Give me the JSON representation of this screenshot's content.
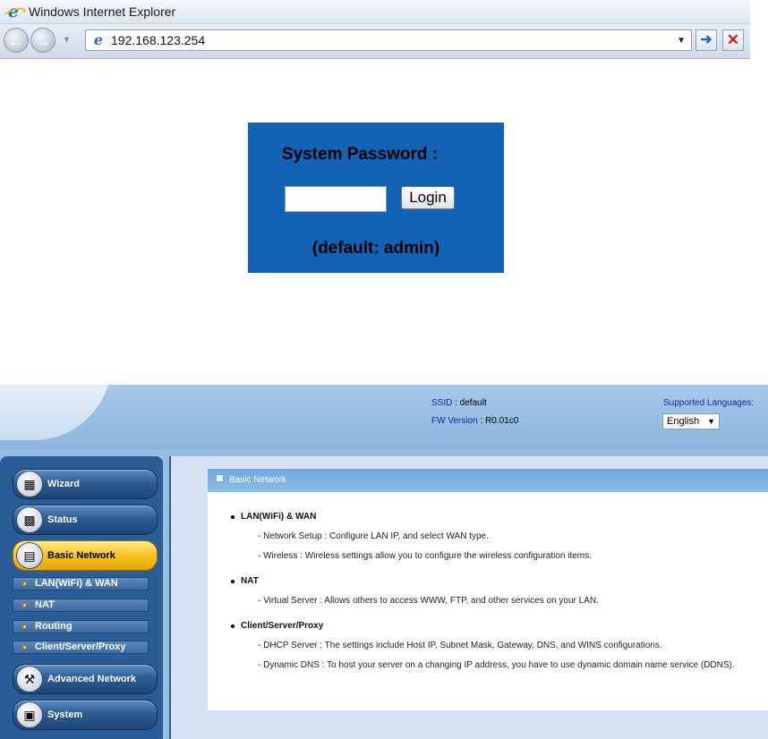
{
  "browser": {
    "window_title": "Windows Internet Explorer",
    "address": "192.168.123.254",
    "icons": [
      "ie-logo-icon",
      "back-arrow-icon",
      "forward-arrow-icon",
      "go-arrow-icon",
      "stop-x-icon"
    ]
  },
  "login": {
    "title": "System Password :",
    "password_value": "",
    "button_label": "Login",
    "hint": "(default: admin)",
    "panel_color": "#1262b6"
  },
  "header": {
    "ssid_label": "SSID",
    "ssid_value": ": default",
    "fw_label": "FW Version",
    "fw_value": ": R0.01c0",
    "languages_label": "Supported Languages:",
    "language_selected": "English"
  },
  "sidebar": {
    "items": [
      {
        "label": "Wizard",
        "icon": "wizard-icon"
      },
      {
        "label": "Status",
        "icon": "status-icon"
      },
      {
        "label": "Basic Network",
        "icon": "basic-network-icon",
        "active": true
      },
      {
        "label": "Advanced Network",
        "icon": "advanced-network-icon"
      },
      {
        "label": "System",
        "icon": "system-icon"
      }
    ],
    "subitems": [
      {
        "label": "LAN(WiFi) & WAN"
      },
      {
        "label": "NAT"
      },
      {
        "label": "Routing"
      },
      {
        "label": "Client/Server/Proxy"
      }
    ]
  },
  "content": {
    "title": "Basic Network",
    "sections": [
      {
        "title": "LAN(WiFi) & WAN",
        "items": [
          "- Network Setup : Configure LAN IP, and select WAN type.",
          "- Wireless : Wireless settings allow you to configure the wireless configuration items."
        ]
      },
      {
        "title": "NAT",
        "items": [
          "- Virtual Server : Allows others to access WWW, FTP, and other services on your LAN."
        ]
      },
      {
        "title": "Client/Server/Proxy",
        "items": [
          "- DHCP Server : The settings include Host IP, Subnet Mask, Gateway, DNS, and WINS configurations.",
          "- Dynamic DNS : To host your server on a changing IP address, you have to use dynamic domain name service (DDNS)."
        ]
      }
    ]
  },
  "colors": {
    "accent_blue": "#2a5c95",
    "active_yellow": "#f7c72a",
    "header_blue": "#98bde3"
  }
}
